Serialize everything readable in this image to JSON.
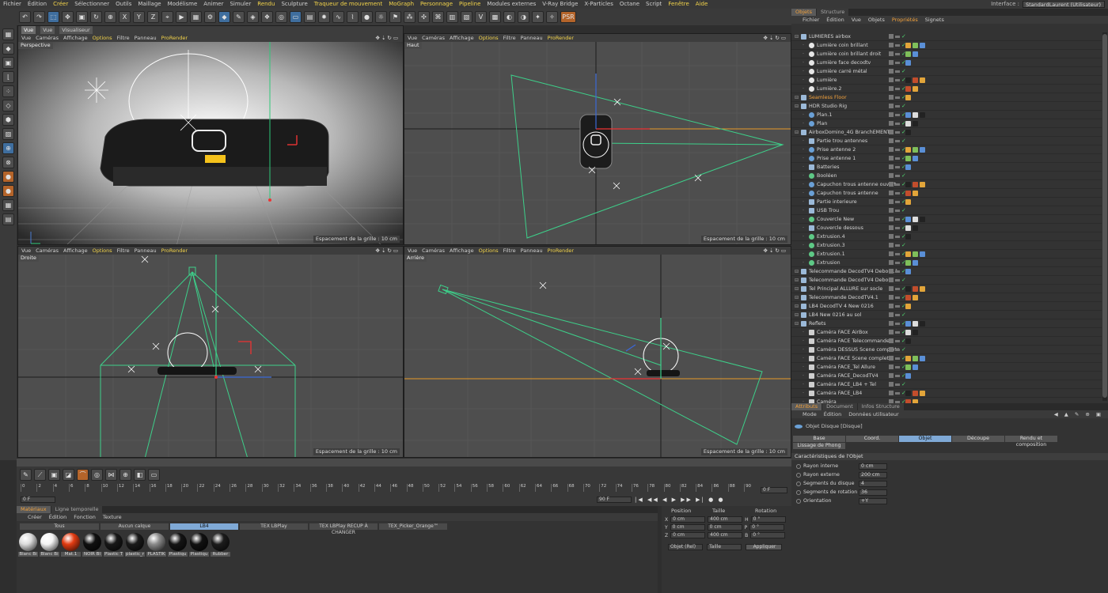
{
  "menu": [
    "Fichier",
    "Édition",
    "Créer",
    "Sélectionner",
    "Outils",
    "Maillage",
    "Modélisme",
    "Animer",
    "Simuler",
    "Rendu",
    "Sculpture",
    "Traqueur de mouvement",
    "MoGraph",
    "Personnage",
    "Pipeline",
    "Modules externes",
    "V-Ray Bridge",
    "X-Particles",
    "Octane",
    "Script",
    "Fenêtre",
    "Aide"
  ],
  "menu_highlight": [
    "Créer",
    "Rendu",
    "Traqueur de mouvement",
    "MoGraph",
    "Personnage",
    "Pipeline",
    "Fenêtre",
    "Aide"
  ],
  "interface": {
    "label": "Interface :",
    "value": "StandardLaurent (Utilisateur)"
  },
  "viewport_tabs": [
    "Vue",
    "Vue",
    "Visualiseur"
  ],
  "viewport_menu": [
    "Vue",
    "Caméras",
    "Affichage",
    "Options",
    "Filtre",
    "Panneau",
    "ProRender"
  ],
  "viewports": [
    {
      "label": "Perspective",
      "grid": "Espacement de la grille : 10 cm"
    },
    {
      "label": "Haut",
      "grid": "Espacement de la grille : 10 cm"
    },
    {
      "label": "Droite",
      "grid": "Espacement de la grille : 10 cm"
    },
    {
      "label": "Arrière",
      "grid": "Espacement de la grille : 10 cm"
    }
  ],
  "object_manager": {
    "tabs": [
      "Objets",
      "Structure"
    ],
    "menu": [
      "Fichier",
      "Édition",
      "Vue",
      "Objets",
      "Propriétés",
      "Signets"
    ],
    "objects": [
      {
        "name": "LUMIÈRES airbox",
        "icon": "L",
        "indent": 0
      },
      {
        "name": "Lumière coin brillant",
        "icon": "lite",
        "indent": 1
      },
      {
        "name": "Lumière coin brillant droit",
        "icon": "lite",
        "indent": 1
      },
      {
        "name": "Lumière face decodtv",
        "icon": "lite",
        "indent": 1
      },
      {
        "name": "Lumière carré métal",
        "icon": "lite",
        "indent": 1
      },
      {
        "name": "Lumière",
        "icon": "lite",
        "indent": 1
      },
      {
        "name": "Lumière.2",
        "icon": "lite",
        "indent": 1
      },
      {
        "name": "Seamless Floor",
        "icon": "L",
        "indent": 0,
        "orange": true
      },
      {
        "name": "HDR Studio Rig",
        "icon": "L",
        "indent": 0
      },
      {
        "name": "Plan.1",
        "icon": "ic",
        "indent": 1
      },
      {
        "name": "Plan",
        "icon": "ic",
        "indent": 1
      },
      {
        "name": "AirboxDomino_4G BranchEMENT",
        "icon": "L",
        "indent": 0
      },
      {
        "name": "Partie trou antennes",
        "icon": "L",
        "indent": 1
      },
      {
        "name": "Prise antenne 2",
        "icon": "ic",
        "indent": 1
      },
      {
        "name": "Prise antenne 1",
        "icon": "ic",
        "indent": 1
      },
      {
        "name": "Batteries",
        "icon": "L",
        "indent": 1
      },
      {
        "name": "Booléen",
        "icon": "grn",
        "indent": 1
      },
      {
        "name": "Capuchon trous antenne ouvert",
        "icon": "ic",
        "indent": 1
      },
      {
        "name": "Capuchon trous antenne",
        "icon": "ic",
        "indent": 1
      },
      {
        "name": "Partie interieure",
        "icon": "L",
        "indent": 1
      },
      {
        "name": "USB Trou",
        "icon": "L",
        "indent": 1
      },
      {
        "name": "Couvercle New",
        "icon": "grn",
        "indent": 1
      },
      {
        "name": "Couvercle dessous",
        "icon": "L",
        "indent": 1
      },
      {
        "name": "Extrusion.4",
        "icon": "grn",
        "indent": 1
      },
      {
        "name": "Extrusion.3",
        "icon": "grn",
        "indent": 1
      },
      {
        "name": "Extrusion.1",
        "icon": "grn",
        "indent": 1
      },
      {
        "name": "Extrusion",
        "icon": "grn",
        "indent": 1
      },
      {
        "name": "Telecommande DecodTV4 Debout.1",
        "icon": "L",
        "indent": 0
      },
      {
        "name": "Telecommande DecodTV4 Debout",
        "icon": "L",
        "indent": 0
      },
      {
        "name": "Tel Principal ALLURE sur socle",
        "icon": "L",
        "indent": 0
      },
      {
        "name": "Telecommande DecodTV4.1",
        "icon": "L",
        "indent": 0
      },
      {
        "name": "LB4 DecodTV 4 New 0216",
        "icon": "L",
        "indent": 0
      },
      {
        "name": "LB4 New 0216 au sol",
        "icon": "L",
        "indent": 0
      },
      {
        "name": "Reflets",
        "icon": "L",
        "indent": 0
      },
      {
        "name": "Caméra FACE AirBox",
        "icon": "cam",
        "indent": 1
      },
      {
        "name": "Caméra FACE Telecommande",
        "icon": "cam",
        "indent": 1
      },
      {
        "name": "Caméra DESSUS Scene complete",
        "icon": "cam",
        "indent": 1
      },
      {
        "name": "Caméra FACE Scene complete",
        "icon": "cam",
        "indent": 1
      },
      {
        "name": "Caméra FACE_Tel Allure",
        "icon": "cam",
        "indent": 1
      },
      {
        "name": "Caméra FACE_DecodTV4",
        "icon": "cam",
        "indent": 1
      },
      {
        "name": "Caméra FACE_LB4 + Tel",
        "icon": "cam",
        "indent": 1
      },
      {
        "name": "Caméra FACE_LB4",
        "icon": "cam",
        "indent": 1
      },
      {
        "name": "Caméra",
        "icon": "cam",
        "indent": 1
      }
    ]
  },
  "attributes": {
    "tabs": [
      "Attributs",
      "Document",
      "Infos Structure"
    ],
    "menu": [
      "Mode",
      "Édition",
      "Données utilisateur"
    ],
    "object_title": "Objet Disque [Disque]",
    "sub_tabs": [
      "Base",
      "Coord.",
      "Objet",
      "Découpe",
      "Rendu et composition",
      "Lissage de Phong"
    ],
    "active_sub_tab": "Objet",
    "section": "Caractéristiques de l'Objet",
    "fields": [
      {
        "label": "Rayon interne",
        "value": "0 cm"
      },
      {
        "label": "Rayon externe",
        "value": "200 cm"
      },
      {
        "label": "Segments du disque",
        "value": "4"
      },
      {
        "label": "Segments de rotation",
        "value": "36"
      },
      {
        "label": "Orientation",
        "value": "+Y"
      }
    ]
  },
  "timeline": {
    "ticks": [
      "0",
      "2",
      "4",
      "6",
      "8",
      "10",
      "12",
      "14",
      "16",
      "18",
      "20",
      "22",
      "24",
      "26",
      "28",
      "30",
      "32",
      "34",
      "36",
      "38",
      "40",
      "42",
      "44",
      "46",
      "48",
      "50",
      "52",
      "54",
      "56",
      "58",
      "60",
      "62",
      "64",
      "66",
      "68",
      "70",
      "72",
      "74",
      "76",
      "78",
      "80",
      "82",
      "84",
      "86",
      "88",
      "90"
    ],
    "start": "0 F",
    "end": "90 F",
    "current": "0 F"
  },
  "materials": {
    "tabs": [
      "Matériaux",
      "Ligne temporelle"
    ],
    "menu": [
      "Créer",
      "Édition",
      "Fonction",
      "Texture"
    ],
    "layers": [
      "Tous",
      "Aucun calque",
      "LB4",
      "TEX LBPlay",
      "TEX LBPlay RECUP À CHANGER",
      "TEX_Picker_Orange™"
    ],
    "active_layer": "LB4",
    "items": [
      {
        "name": "Blanc Bi",
        "color": "#dcdcdc"
      },
      {
        "name": "Blanc Bi",
        "color": "#f4f4f4"
      },
      {
        "name": "Mat.1",
        "color": "#e23c12"
      },
      {
        "name": "NOIR BI",
        "color": "#101010"
      },
      {
        "name": "Plastic T",
        "color": "#181818"
      },
      {
        "name": "plastic_r",
        "color": "#1a1a1a"
      },
      {
        "name": "PLASTIK",
        "color": "#8a8a8a"
      },
      {
        "name": "Plastiqu",
        "color": "#141414"
      },
      {
        "name": "Plastiqu",
        "color": "#111111"
      },
      {
        "name": "Rubber",
        "color": "#1c1c1c"
      }
    ]
  },
  "coordinates": {
    "headers": [
      "Position",
      "Taille",
      "Rotation"
    ],
    "rows": [
      {
        "axis": "X",
        "pos": "0 cm",
        "size": "400 cm",
        "rot_axis": "H",
        "rot": "0 °"
      },
      {
        "axis": "Y",
        "pos": "0 cm",
        "size": "0 cm",
        "rot_axis": "P",
        "rot": "0 °"
      },
      {
        "axis": "Z",
        "pos": "0 cm",
        "size": "400 cm",
        "rot_axis": "B",
        "rot": "0 °"
      }
    ],
    "mode": "Objet (Rel)",
    "size_mode": "Taille",
    "apply": "Appliquer"
  },
  "colors": {
    "accent": "#f2a13b",
    "selection": "#7fa9d6",
    "green": "#3dd08a",
    "yellow": "#f2d34a"
  }
}
